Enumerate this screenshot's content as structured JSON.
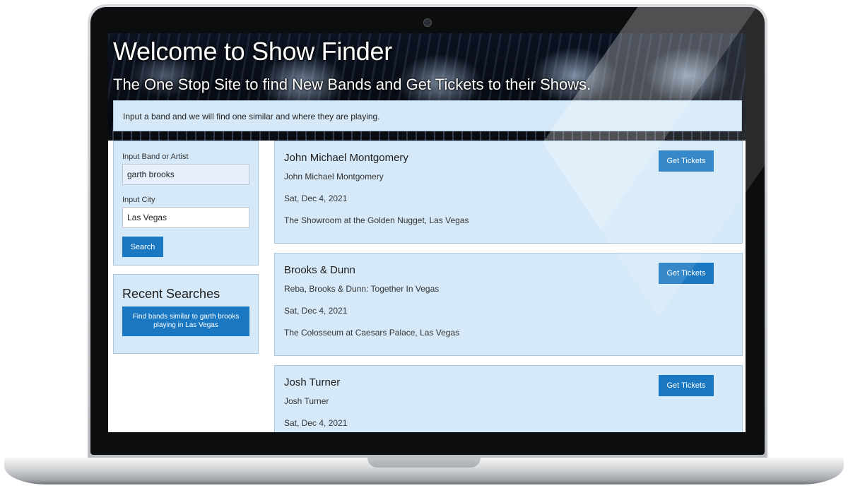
{
  "header": {
    "title": "Welcome to Show Finder",
    "subtitle": "The One Stop Site to find New Bands and Get Tickets to their Shows.",
    "intro": "Input a band and we will find one similar and where they are playing."
  },
  "search": {
    "band_label": "Input Band or Artist",
    "band_value": "garth brooks",
    "city_label": "Input City",
    "city_value": "Las Vegas",
    "button_label": "Search"
  },
  "recent": {
    "title": "Recent Searches",
    "items": [
      {
        "label": "Find bands similar to garth brooks playing in Las Vegas"
      }
    ]
  },
  "results": [
    {
      "artist": "John Michael Montgomery",
      "event": "John Michael Montgomery",
      "date": "Sat, Dec 4, 2021",
      "venue": "The Showroom at the Golden Nugget, Las Vegas",
      "button_label": "Get Tickets"
    },
    {
      "artist": "Brooks & Dunn",
      "event": "Reba, Brooks & Dunn: Together In Vegas",
      "date": "Sat, Dec 4, 2021",
      "venue": "The Colosseum at Caesars Palace, Las Vegas",
      "button_label": "Get Tickets"
    },
    {
      "artist": "Josh Turner",
      "event": "Josh Turner",
      "date": "Sat, Dec 4, 2021",
      "venue": "",
      "button_label": "Get Tickets"
    }
  ],
  "colors": {
    "panel_bg": "#d6e9f8",
    "panel_border": "#a9c6de",
    "button_blue": "#1a78c2",
    "hero_dark": "#0b1220"
  }
}
